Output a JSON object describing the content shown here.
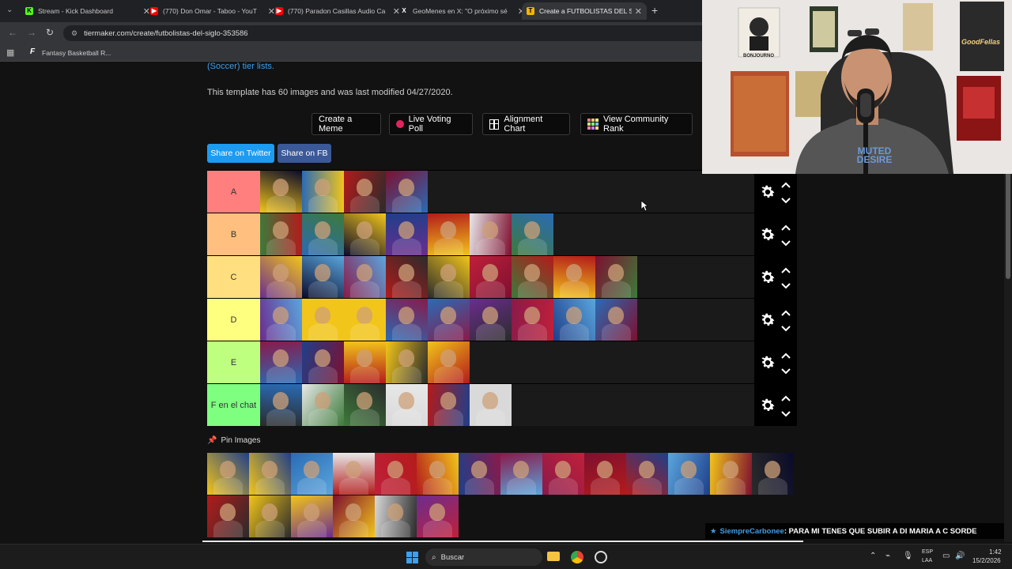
{
  "browser": {
    "tabs": [
      {
        "title": "Stream - Kick Dashboard",
        "favicon": "K",
        "color": "#53fc18"
      },
      {
        "title": "(770) Don Omar - Taboo - YouT",
        "favicon": "▶",
        "color": "#ff0000"
      },
      {
        "title": "(770) Paradon Casillas Audio Ca",
        "favicon": "▶",
        "color": "#ff0000"
      },
      {
        "title": "GeoMenes en X: \"O próximo sé",
        "favicon": "X",
        "color": "#000000"
      },
      {
        "title": "Create a FUTBOLISTAS DEL SIGL",
        "favicon": "T",
        "color": "#f4b400"
      }
    ],
    "url": "tiermaker.com/create/futbolistas-del-siglo-353586",
    "bookmark": "Fantasy Basketball R..."
  },
  "page": {
    "category_link": "(Soccer) tier lists.",
    "template_info": "This template has 60 images and was last modified 04/27/2020.",
    "buttons": {
      "create_meme": "Create a Meme",
      "live_voting": "Live Voting Poll",
      "alignment_chart": "Alignment Chart",
      "community_rank": "View Community Rank"
    },
    "share": {
      "twitter": "Share on Twitter",
      "facebook": "Share on FB",
      "twitter_color": "#1d9bf0",
      "facebook_color": "#3b5998"
    },
    "tiers": [
      {
        "label": "A",
        "color": "#ff7f7f",
        "count": 4
      },
      {
        "label": "B",
        "color": "#ffbf7f",
        "count": 7
      },
      {
        "label": "C",
        "color": "#ffdf7f",
        "count": 9
      },
      {
        "label": "D",
        "color": "#ffff7f",
        "count": 9
      },
      {
        "label": "E",
        "color": "#bfff7f",
        "count": 5
      },
      {
        "label": "F en el chat",
        "color": "#7fff7f",
        "count": 6
      }
    ],
    "pin_images_label": "Pin Images",
    "pool_counts": [
      14,
      6
    ]
  },
  "chat": {
    "user": "SiempreCarbonee",
    "message": ": PARA MI TENES QUE SUBIR A DI MARIA A C SORDE",
    "user_color": "#3f9de6"
  },
  "webcam": {
    "poster_text_1": "BONJOURNO",
    "poster_text_2": "GoodFellas",
    "shirt_text": "MUTED DESIRE"
  },
  "taskbar": {
    "search_placeholder": "Buscar",
    "lang_1": "ESP",
    "lang_2": "LAA",
    "time": "1:42",
    "date": "15/2/2026"
  }
}
